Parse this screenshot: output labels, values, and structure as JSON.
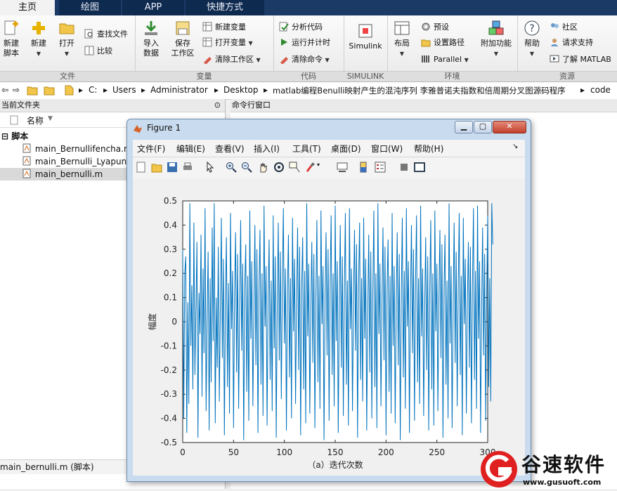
{
  "tabs": [
    {
      "label": "主页"
    },
    {
      "label": "绘图"
    },
    {
      "label": "APP"
    },
    {
      "label": "快捷方式"
    }
  ],
  "ribbon": {
    "file": {
      "name": "文件",
      "new_script": "新建\n脚本",
      "new": "新建",
      "open": "打开",
      "find_files": "查找文件",
      "compare": "比较"
    },
    "variable": {
      "name": "变量",
      "import": "导入\n数据",
      "save": "保存\n工作区",
      "new_var": "新建变量",
      "open_var": "打开变量",
      "clear_ws": "清除工作区"
    },
    "code": {
      "name": "代码",
      "analyze": "分析代码",
      "run_time": "运行并计时",
      "clear_cmd": "清除命令"
    },
    "simulink": {
      "name": "SIMULINK",
      "label": "Simulink"
    },
    "env": {
      "name": "环境",
      "layout": "布局",
      "prefs": "预设",
      "set_path": "设置路径",
      "parallel": "Parallel",
      "addons": "附加功能"
    },
    "resources": {
      "name": "资源",
      "help": "帮助",
      "community": "社区",
      "support": "请求支持",
      "learn": "了解 MATLAB"
    }
  },
  "address": {
    "crumbs": [
      "C:",
      "Users",
      "Administrator",
      "Desktop",
      "matlab编程Benulli映射产生的混沌序列 李雅普诺夫指数和倍周期分叉图源码程序",
      "code"
    ]
  },
  "left": {
    "title": "当前文件夹",
    "col_name": "名称",
    "folder": "脚本",
    "files": [
      {
        "name": "main_Bernullifencha.m"
      },
      {
        "name": "main_Bernulli_Lyapuno"
      },
      {
        "name": "main_bernulli.m"
      }
    ],
    "status": "main_bernulli.m  (脚本)"
  },
  "cmd": {
    "title": "命令行窗口"
  },
  "figure": {
    "title": "Figure 1",
    "menu": [
      {
        "label": "文件(F)"
      },
      {
        "label": "编辑(E)"
      },
      {
        "label": "查看(V)"
      },
      {
        "label": "插入(I)"
      },
      {
        "label": "工具(T)"
      },
      {
        "label": "桌面(D)"
      },
      {
        "label": "窗口(W)"
      },
      {
        "label": "帮助(H)"
      }
    ]
  },
  "chart_data": {
    "type": "line",
    "xlabel": "（a）迭代次数",
    "ylabel": "幅度",
    "xlim": [
      0,
      300
    ],
    "ylim": [
      -0.5,
      0.5
    ],
    "xticks": [
      0,
      50,
      100,
      150,
      200,
      250,
      300
    ],
    "yticks": [
      0.5,
      0.4,
      0.3,
      0.2,
      0.1,
      0,
      -0.1,
      -0.2,
      -0.3,
      -0.4,
      -0.5
    ],
    "color": "#0072bd",
    "series": [
      {
        "values": [
          0.3,
          -0.4,
          0.2,
          0.27,
          -0.46,
          0.08,
          -0.34,
          0.49,
          -0.1,
          0.15,
          -0.28,
          0.41,
          -0.22,
          0.05,
          0.33,
          -0.48,
          0.12,
          -0.05,
          0.36,
          -0.31,
          0.22,
          -0.13,
          0.47,
          -0.37,
          0.02,
          0.29,
          -0.45,
          0.18,
          -0.25,
          0.39,
          -0.08,
          0.49,
          -0.42,
          0.1,
          -0.19,
          0.31,
          -0.33,
          0.04,
          0.43,
          -0.15,
          0.26,
          -0.47,
          0.09,
          0.35,
          -0.27,
          0.16,
          -0.38,
          0.45,
          -0.03,
          0.21,
          -0.44,
          0.11,
          0.37,
          -0.21,
          0.28,
          -0.36,
          0.06,
          0.42,
          -0.12,
          0.24,
          -0.49,
          0.14,
          0.32,
          -0.29,
          0.19,
          -0.41,
          0.46,
          -0.07,
          0.25,
          -0.35,
          0.03,
          0.4,
          -0.18,
          0.3,
          -0.46,
          0.13,
          0.38,
          -0.26,
          0.2,
          -0.39,
          0.48,
          -0.02,
          0.23,
          -0.43,
          0.1,
          0.34,
          -0.24,
          0.17,
          -0.37,
          0.44,
          -0.11,
          0.27,
          -0.48,
          0.07,
          0.41,
          -0.16,
          0.29,
          -0.32,
          0.15,
          0.47,
          -0.09,
          0.22,
          -0.45,
          0.12,
          0.36,
          -0.23,
          0.18,
          -0.4,
          0.43,
          -0.04,
          0.26,
          -0.34,
          0.08,
          0.39,
          -0.2,
          0.31,
          -0.47,
          0.14,
          0.35,
          -0.28,
          0.21,
          -0.42,
          0.49,
          -0.06,
          0.24,
          -0.38,
          0.05,
          0.33,
          -0.17,
          0.28,
          -0.44,
          0.11,
          0.42,
          -0.25,
          0.19,
          -0.36,
          0.46,
          -0.01,
          0.23,
          -0.49,
          0.09,
          0.37,
          -0.14,
          0.3,
          -0.41,
          0.16,
          0.44,
          -0.22,
          0.2,
          -0.35,
          0.48,
          -0.08,
          0.25,
          -0.46,
          0.06,
          0.4,
          -0.19,
          0.27,
          -0.39,
          0.13,
          0.45,
          -0.26,
          0.17,
          -0.43,
          0.47,
          -0.03,
          0.22,
          -0.37,
          0.1,
          0.38,
          -0.12,
          0.32,
          -0.48,
          0.15,
          0.41,
          -0.24,
          0.18,
          -0.33,
          0.43,
          -0.07,
          0.26,
          -0.45,
          0.04,
          0.36,
          -0.21,
          0.29,
          -0.4,
          0.12,
          0.46,
          -0.27,
          0.2,
          -0.44,
          0.49,
          -0.05,
          0.24,
          -0.35,
          0.08,
          0.39,
          -0.16,
          0.31,
          -0.47,
          0.14,
          0.34,
          -0.29,
          0.19,
          -0.38,
          0.45,
          -0.1,
          0.23,
          -0.42,
          0.07,
          0.37,
          -0.18,
          0.28,
          -0.49,
          0.11,
          0.43,
          -0.23,
          0.21,
          -0.36,
          0.47,
          -0.02,
          0.25,
          -0.46,
          0.09,
          0.4,
          -0.13,
          0.3,
          -0.41,
          0.16,
          0.44,
          -0.25,
          0.18,
          -0.34,
          0.48,
          -0.06,
          0.22,
          -0.39,
          0.05,
          0.35,
          -0.2,
          0.27,
          -0.45,
          0.13,
          0.42,
          -0.28,
          0.2,
          -0.43,
          0.46,
          -0.04,
          0.24,
          -0.37,
          0.1,
          0.38,
          -0.15,
          0.32,
          -0.48,
          0.12,
          0.36,
          -0.26,
          0.17,
          -0.4,
          0.49,
          -0.09,
          0.23,
          -0.44,
          0.06,
          0.41,
          -0.17,
          0.29,
          -0.35,
          0.14,
          0.45,
          -0.22,
          0.19,
          -0.47,
          0.43,
          -0.01,
          0.26,
          -0.38,
          0.08,
          0.33,
          -0.19,
          0.31,
          -0.42,
          0.15,
          0.47,
          -0.24,
          0.21,
          -0.36,
          0.48,
          -0.07,
          0.25,
          -0.46,
          0.04,
          0.39,
          -0.14,
          0.28,
          -0.41,
          0.11,
          0.44,
          -0.27,
          0.18,
          -0.33,
          0.49,
          0.32
        ]
      }
    ]
  },
  "watermark": {
    "brand": "谷速软件",
    "url": "www.gusuoft.com"
  }
}
